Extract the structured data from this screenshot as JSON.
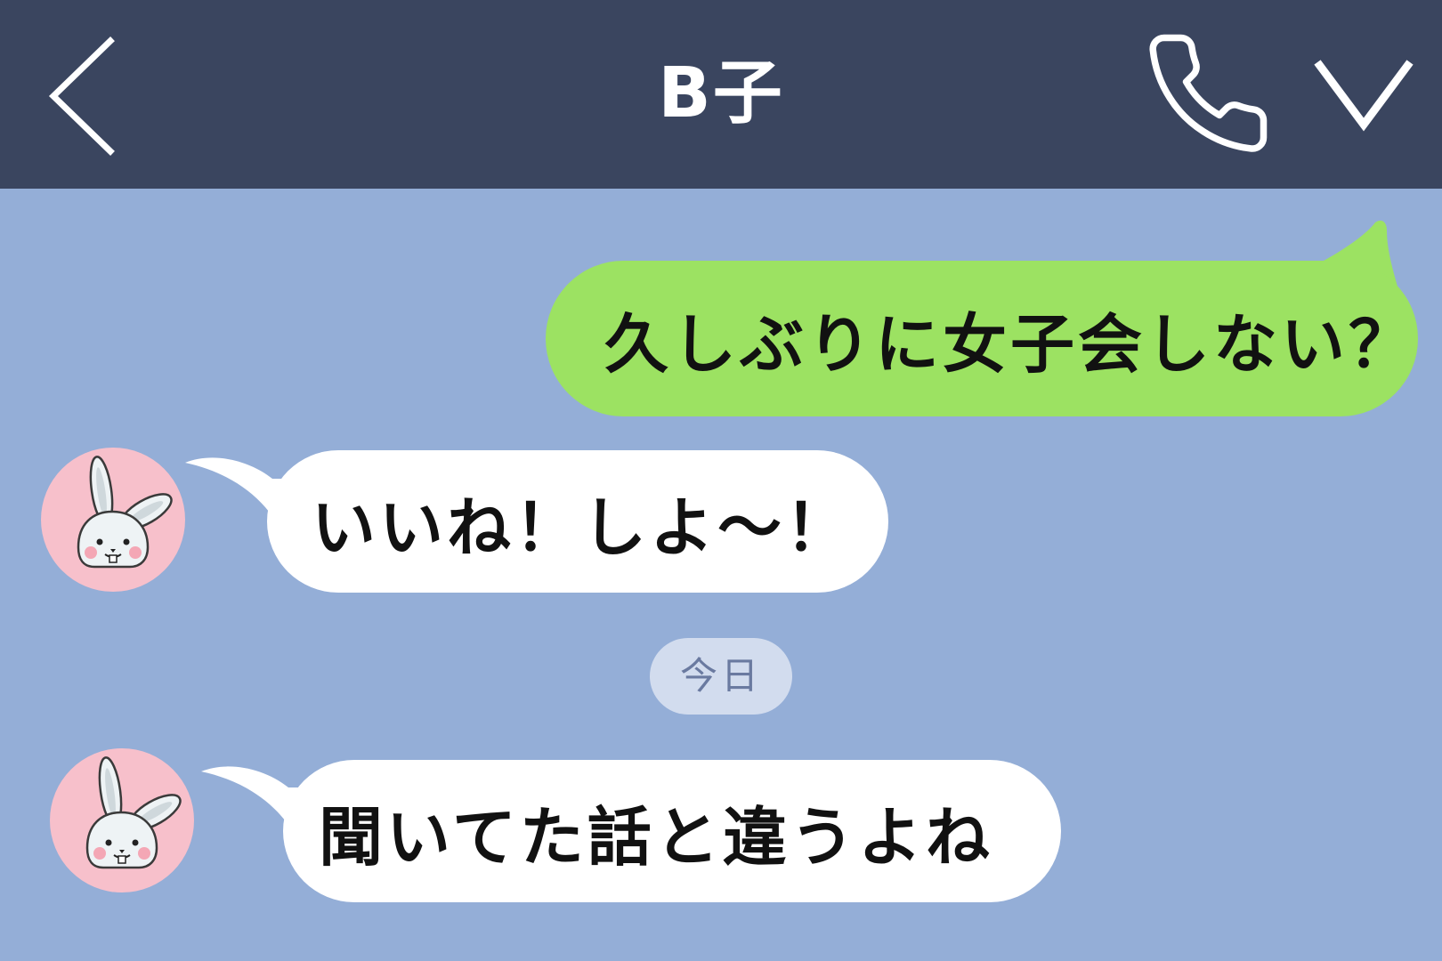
{
  "header": {
    "title": "B子",
    "back_icon": "chevron-left-icon",
    "call_icon": "phone-icon",
    "menu_icon": "chevron-down-icon",
    "background_color": "#3a455f"
  },
  "chat": {
    "background_color": "#94aed7",
    "messages": [
      {
        "sender": "me",
        "text": "久しぶりに女子会しない？",
        "bubble_color": "#9ce262"
      },
      {
        "sender": "B子",
        "text": "いいね！しよ〜！",
        "bubble_color": "#ffffff",
        "avatar": "rabbit-avatar"
      },
      {
        "sender": "B子",
        "text": "聞いてた話と違うよね",
        "bubble_color": "#ffffff",
        "avatar": "rabbit-avatar"
      }
    ],
    "date_separator": "今日"
  }
}
